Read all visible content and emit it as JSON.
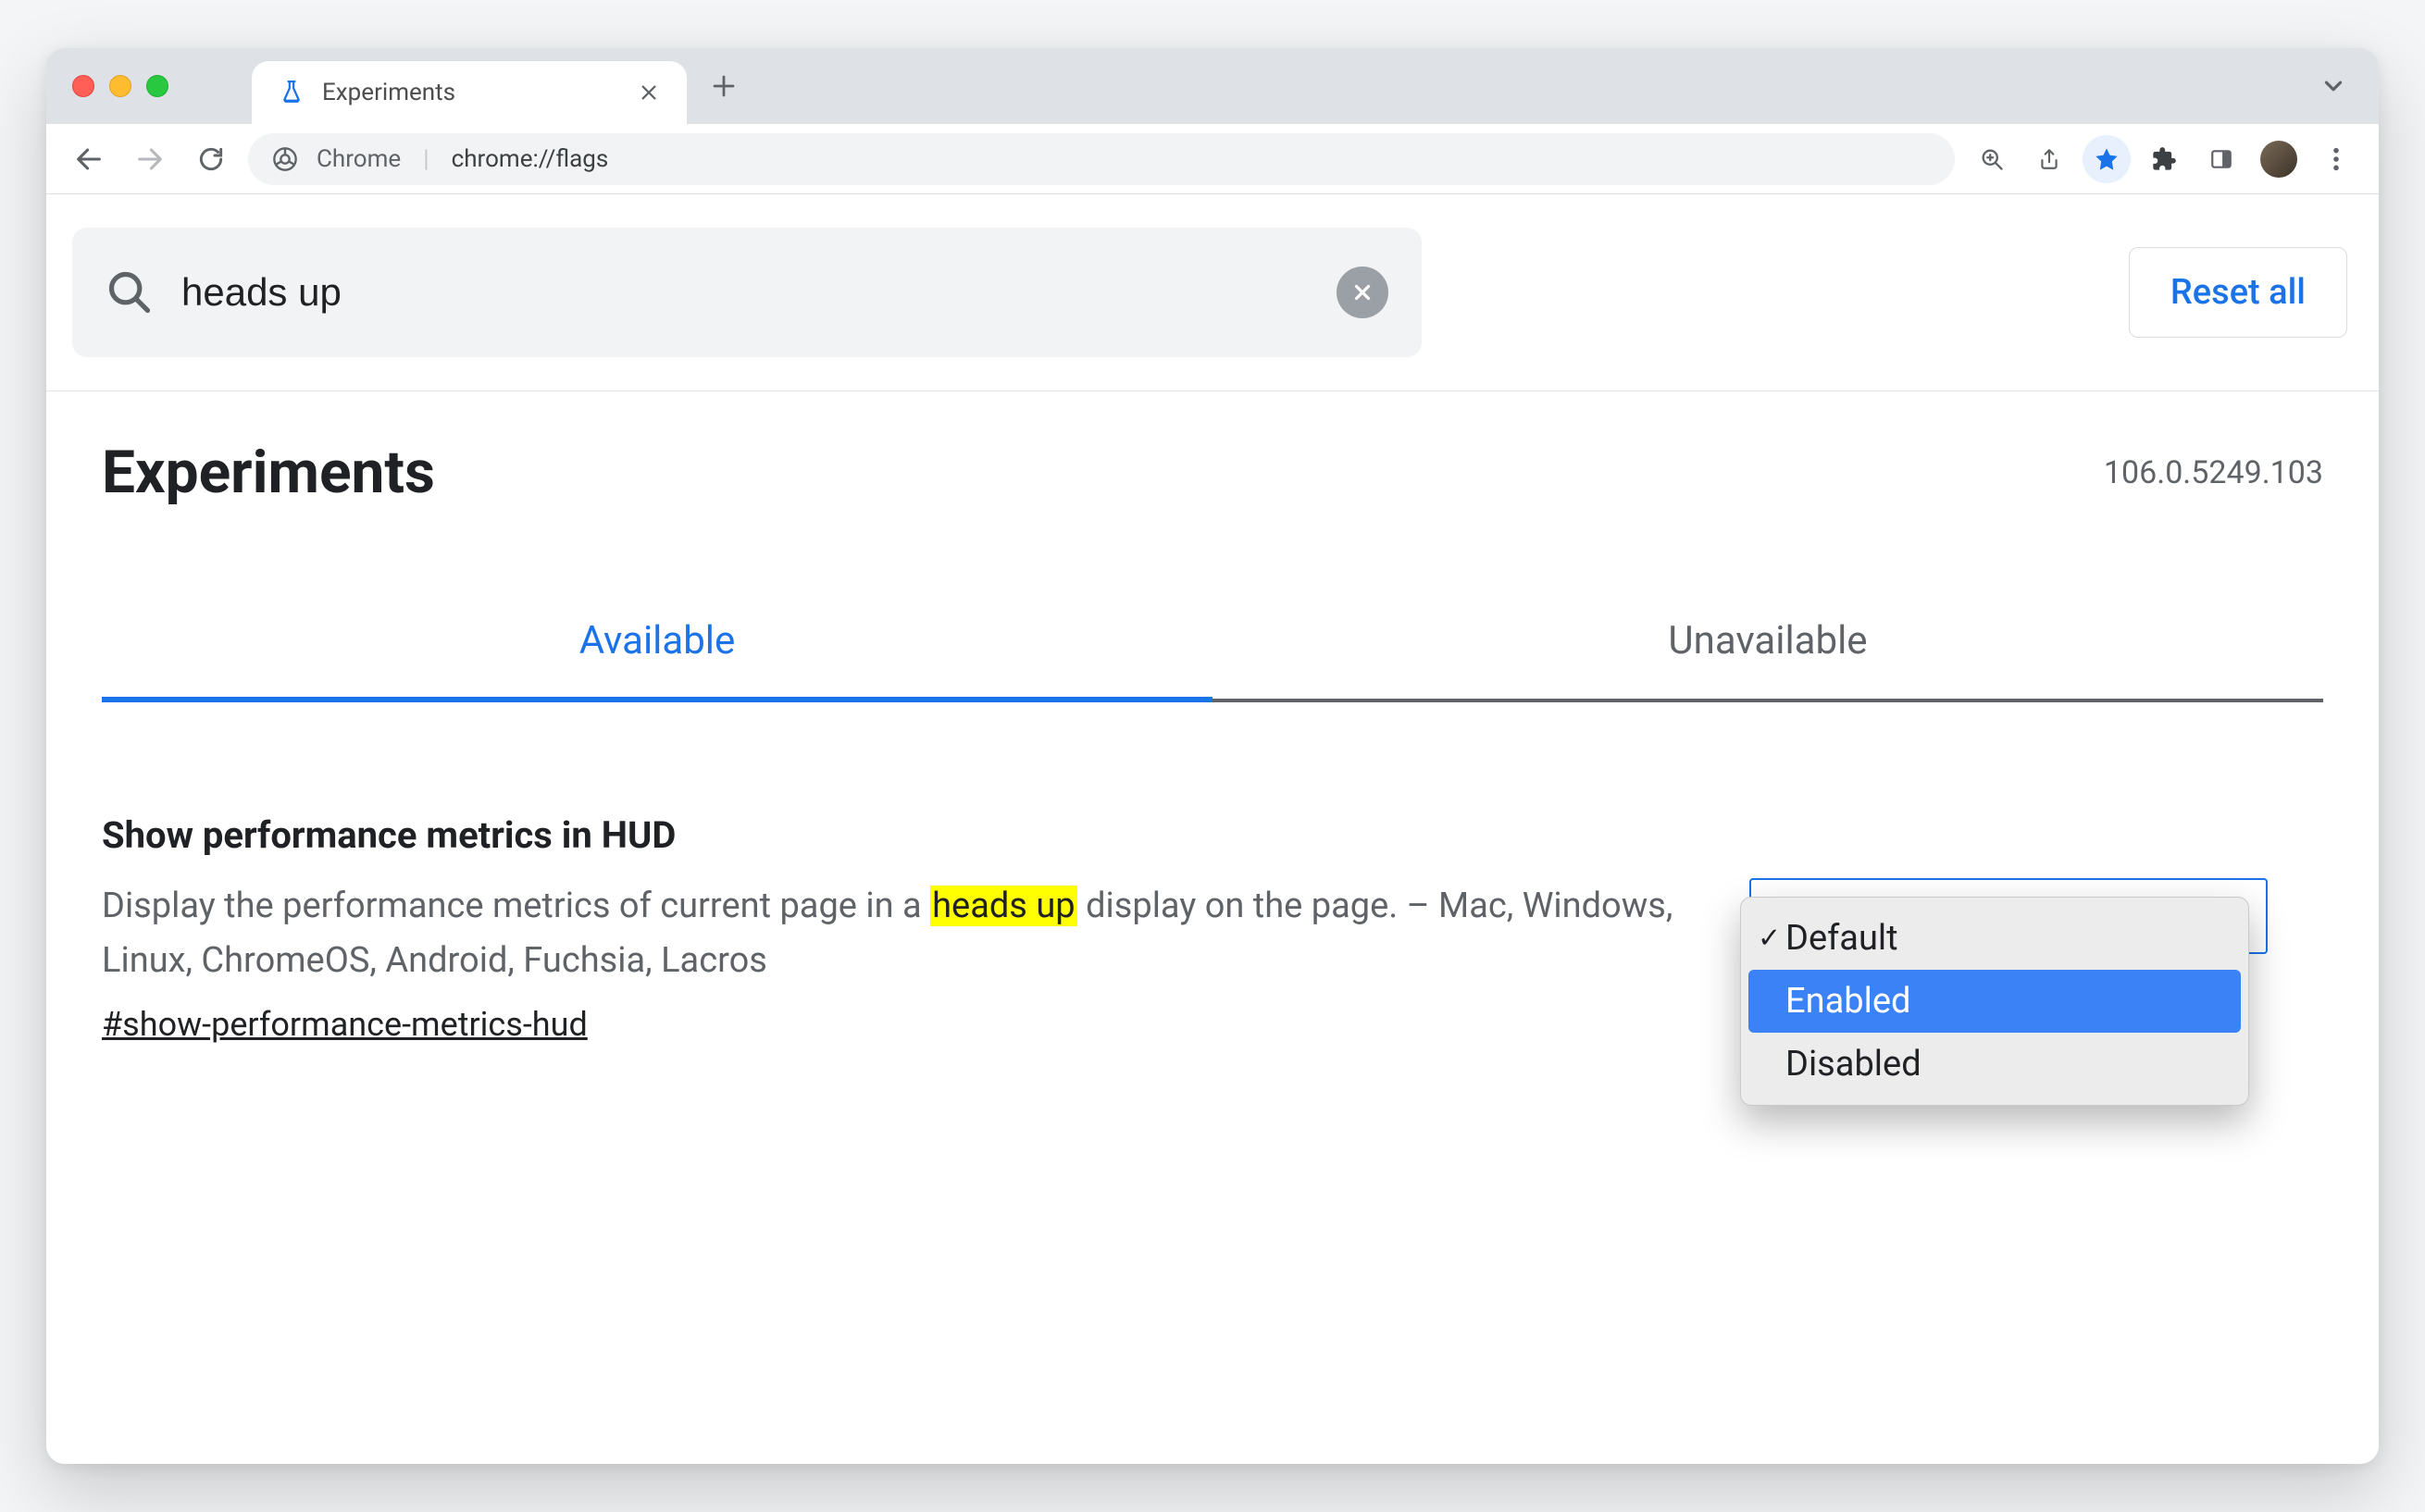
{
  "browser": {
    "tab_title": "Experiments",
    "omnibox_label": "Chrome",
    "omnibox_url": "chrome://flags"
  },
  "search": {
    "value": "heads up",
    "reset_label": "Reset all"
  },
  "page": {
    "title": "Experiments",
    "version": "106.0.5249.103",
    "tab_available": "Available",
    "tab_unavailable": "Unavailable"
  },
  "flag": {
    "title": "Show performance metrics in HUD",
    "description_before": "Display the performance metrics of current page in a ",
    "description_highlight": "heads up",
    "description_after": " display on the page. – Mac, Windows, Linux, ChromeOS, Android, Fuchsia, Lacros",
    "anchor": "#show-performance-metrics-hud",
    "options": {
      "default": "Default",
      "enabled": "Enabled",
      "disabled": "Disabled"
    }
  }
}
